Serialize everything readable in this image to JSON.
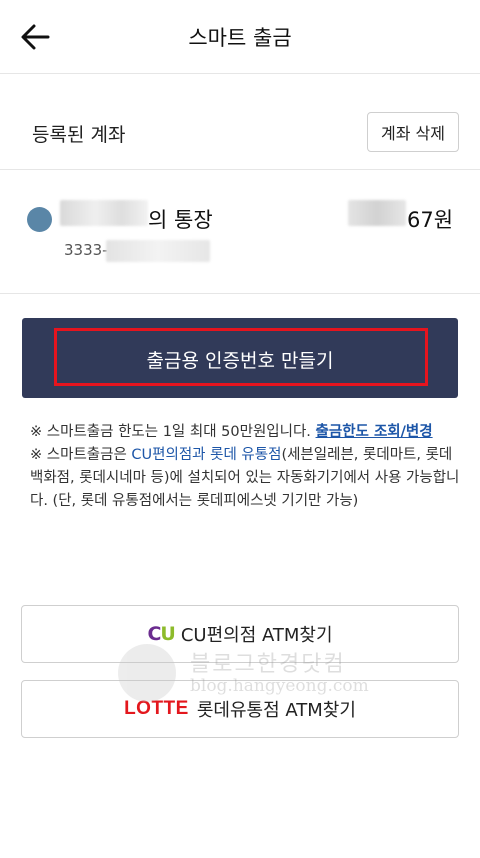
{
  "header": {
    "title": "스마트 출금",
    "back_icon": "arrow-left-icon"
  },
  "account_section": {
    "label": "등록된 계좌",
    "delete_button": "계좌 삭제"
  },
  "account": {
    "name_suffix": "의 통장",
    "amount_suffix": "67원",
    "number_prefix": "3333-",
    "dot_color": "#5a86a7"
  },
  "cta": {
    "label": "출금용 인증번호 만들기",
    "bg_color": "#313a59",
    "highlight_color": "#e6141e"
  },
  "notes": {
    "note1_text": "※ 스마트출금 한도는 1일 최대 50만원입니다.",
    "note1_link": "출금한도 조회/변경",
    "note2_prefix": "※ 스마트출금은",
    "note2_highlight": "CU편의점과 롯데 유통점",
    "note2_suffix": "(세븐일레븐, 롯데마트, 롯데백화점, 롯데시네마 등)에 설치되어 있는 자동화기기에서 사용 가능합니다. (단, 롯데 유통점에서는 롯데피에스넷 기기만 가능)"
  },
  "atm_buttons": [
    {
      "logo_c": "C",
      "logo_u": "U",
      "label": "CU편의점 ATM찾기"
    },
    {
      "logo": "LOTTE",
      "label": "롯데유통점 ATM찾기"
    }
  ],
  "watermark": {
    "title": "블로그한경닷컴",
    "url": "blog.hangyeong.com"
  }
}
